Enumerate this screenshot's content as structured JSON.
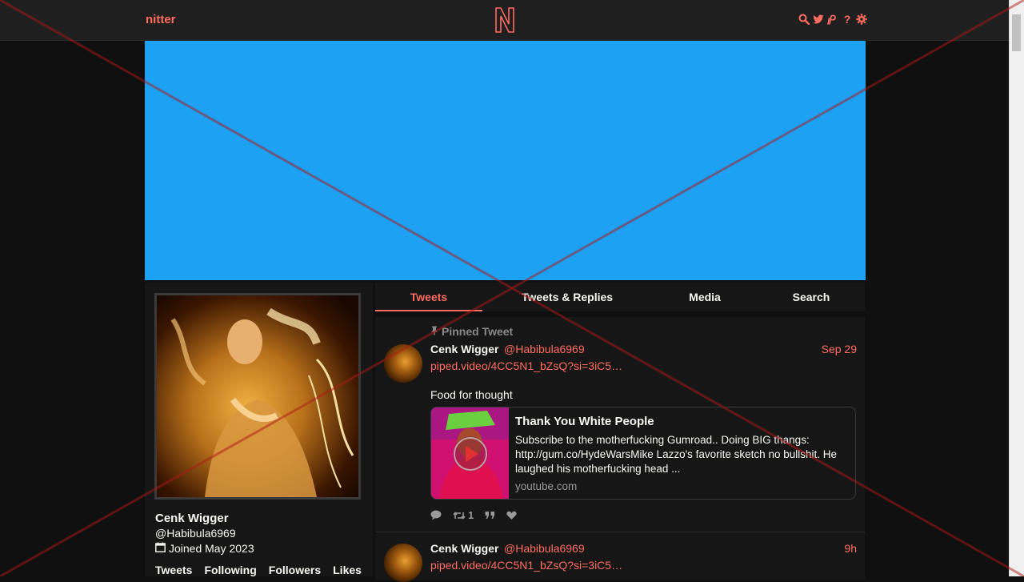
{
  "nav": {
    "brand": "nitter",
    "logo_letter": "N",
    "icons": [
      "search-icon",
      "twitter-icon",
      "rss-icon",
      "help-icon",
      "gear-icon"
    ],
    "help_glyph": "?"
  },
  "colors": {
    "accent": "#ff6c60",
    "banner": "#1da1f2",
    "background": "#0f0f0f",
    "panel": "#161616"
  },
  "profile": {
    "fullname": "Cenk Wigger",
    "username": "@Habibula6969",
    "joined": "Joined May 2023",
    "stats": [
      "Tweets",
      "Following",
      "Followers",
      "Likes"
    ]
  },
  "tabs": [
    {
      "label": "Tweets",
      "active": true
    },
    {
      "label": "Tweets & Replies",
      "active": false
    },
    {
      "label": "Media",
      "active": false
    },
    {
      "label": "Search",
      "active": false
    }
  ],
  "tweets": [
    {
      "pinned_label": "Pinned Tweet",
      "fullname": "Cenk Wigger",
      "username": "@Habibula6969",
      "date": "Sep 29",
      "link": "piped.video/4CC5N1_bZsQ?si=3iC5…",
      "text": "Food for thought",
      "card": {
        "title": "Thank You White People",
        "description": "Subscribe to the motherfucking Gumroad.. Doing BIG thangs: http://gum.co/HydeWarsMike Lazzo's favorite sketch no bullshit. He laughed his motherfucking head ...",
        "domain": "youtube.com"
      },
      "retweets": "1"
    },
    {
      "fullname": "Cenk Wigger",
      "username": "@Habibula6969",
      "date": "9h",
      "link": "piped.video/4CC5N1_bZsQ?si=3iC5…"
    }
  ]
}
